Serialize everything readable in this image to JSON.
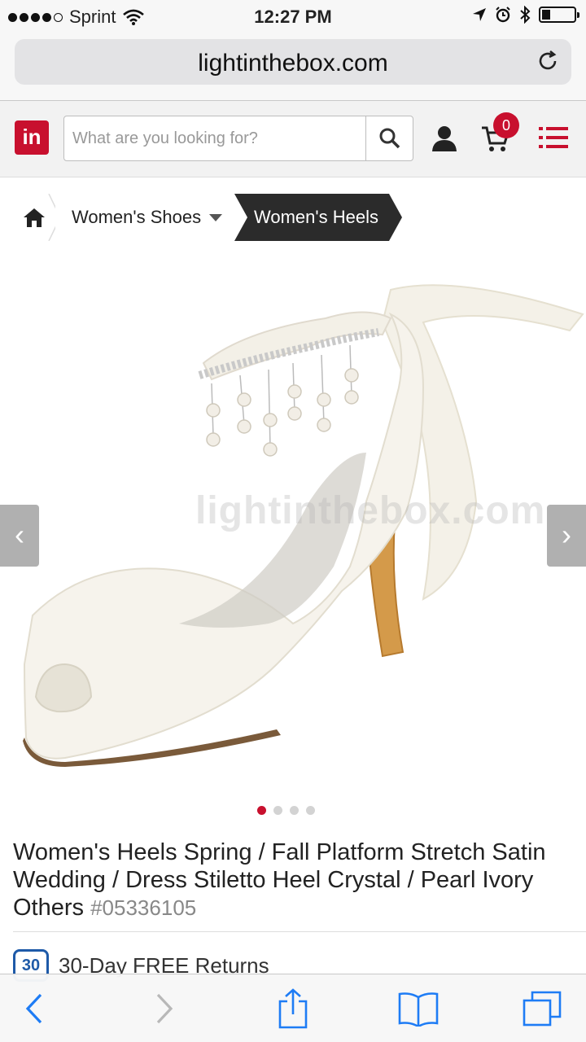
{
  "status_bar": {
    "carrier": "Sprint",
    "time": "12:27 PM"
  },
  "browser": {
    "url": "lightinthebox.com"
  },
  "header": {
    "logo_text": "in",
    "search_placeholder": "What are you looking for?",
    "cart_count": "0"
  },
  "breadcrumb": {
    "items": [
      {
        "label": "Women's Shoes"
      },
      {
        "label": "Women's Heels"
      }
    ]
  },
  "gallery": {
    "watermark": "lightinthebox.com",
    "prev_label": "‹",
    "next_label": "›",
    "slide_count": 4,
    "active_index": 0
  },
  "product": {
    "title": "Women's Heels Spring / Fall Platform Stretch Satin Wedding / Dress Stiletto Heel Crystal / Pearl Ivory Others",
    "code": "#05336105"
  },
  "returns": {
    "badge": "30",
    "text": "30-Day FREE Returns"
  },
  "colors": {
    "brand_red": "#c8102e",
    "breadcrumb_active_bg": "#2b2b2b",
    "ios_blue": "#1e7cf5"
  }
}
